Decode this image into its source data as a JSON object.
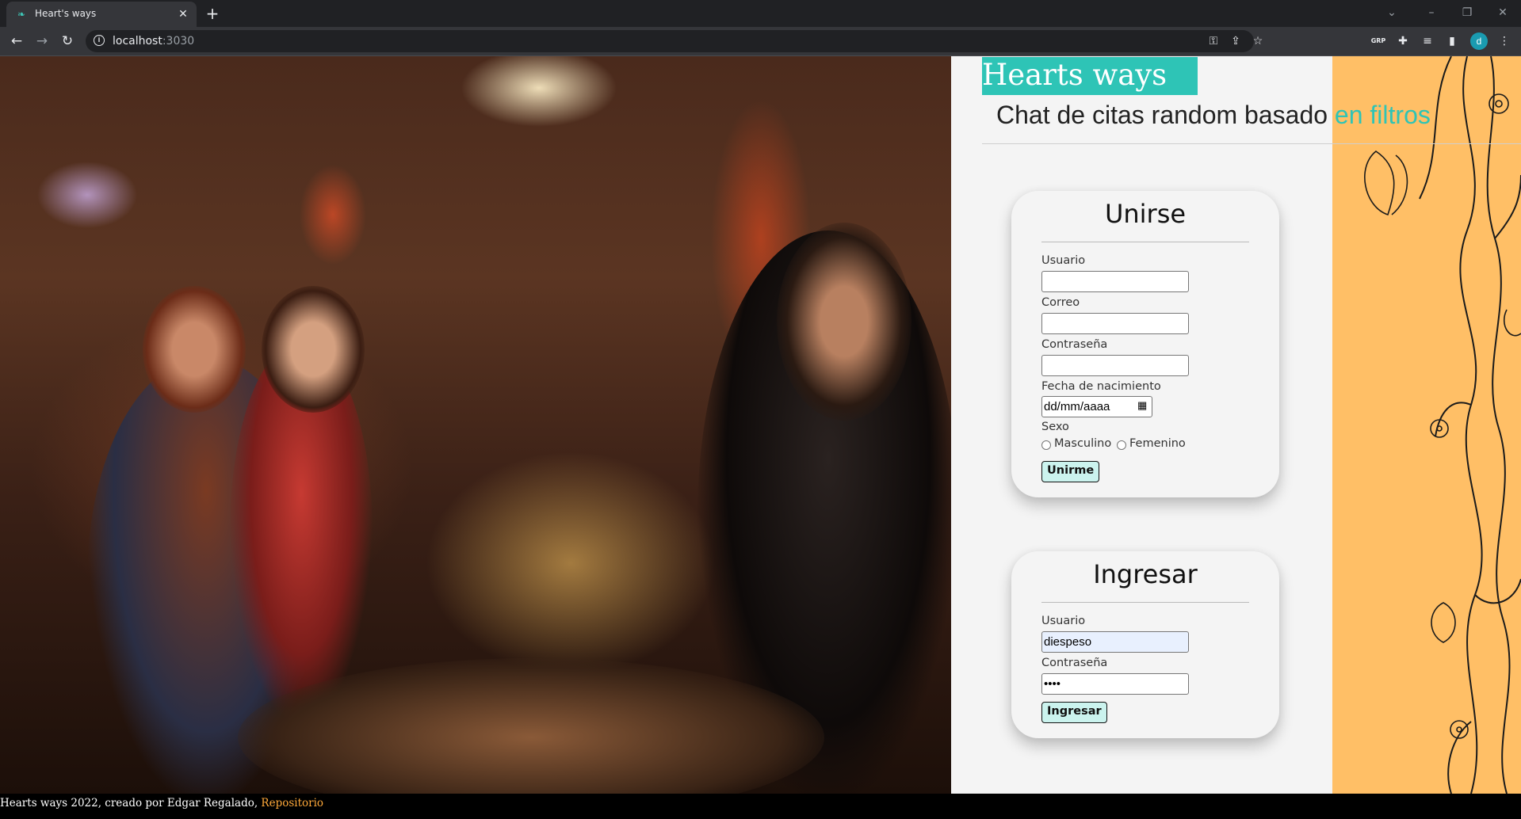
{
  "browser": {
    "tab_title": "Heart's ways",
    "tab_icon": "heart-logo-icon",
    "url_host": "localhost",
    "url_port": ":3030",
    "extension_grp_label": "GRP",
    "profile_initial": "d"
  },
  "header": {
    "title": "Hearts ways",
    "subtitle": "Chat de citas random basado",
    "subtitle_accent": "en filtros"
  },
  "signup": {
    "title": "Unirse",
    "user_label": "Usuario",
    "user_value": "",
    "email_label": "Correo",
    "email_value": "",
    "password_label": "Contraseña",
    "password_value": "",
    "birth_label": "Fecha de nacimiento",
    "birth_placeholder": "dd/mm/aaaa",
    "sex_label": "Sexo",
    "sex_options": [
      "Masculino",
      "Femenino"
    ],
    "submit_label": "Unirme"
  },
  "login": {
    "title": "Ingresar",
    "user_label": "Usuario",
    "user_value": "diespeso",
    "password_label": "Contraseña",
    "password_value": "••••",
    "submit_label": "Ingresar"
  },
  "footer": {
    "text": "Hearts ways 2022, creado por Edgar Regalado, ",
    "link": "Repositorio"
  },
  "colors": {
    "accent": "#2ec4b6",
    "deco_panel": "#ffbf66",
    "footer_link": "#ffa93a",
    "button_bg": "#cbf3ee"
  }
}
